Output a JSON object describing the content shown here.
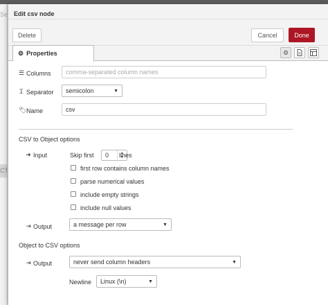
{
  "left_strip": {
    "frag_top": "Se",
    "frag_mid": "CT"
  },
  "tray": {
    "title": "Edit csv node",
    "delete_label": "Delete",
    "cancel_label": "Cancel",
    "done_label": "Done",
    "accent_color": "#ad1625"
  },
  "tabs": {
    "properties_label": "Properties",
    "icons": [
      "gear-icon",
      "file-icon",
      "appearance-icon"
    ]
  },
  "form": {
    "columns_label": "Columns",
    "columns_placeholder": "comma-separated column names",
    "separator_label": "Separator",
    "separator_value": "semicolon",
    "name_label": "Name",
    "name_value": "csv"
  },
  "csv_to_object": {
    "title": "CSV to Object options",
    "input_label": "Input",
    "skip_first_label": "Skip first",
    "skip_first_value": "0",
    "lines_label": "lines",
    "checkboxes": [
      {
        "label": "first row contains column names",
        "checked": false
      },
      {
        "label": "parse numerical values",
        "checked": false
      },
      {
        "label": "include empty strings",
        "checked": false
      },
      {
        "label": "include null values",
        "checked": false
      }
    ],
    "output_label": "Output",
    "output_value": "a message per row"
  },
  "object_to_csv": {
    "title": "Object to CSV options",
    "output_label": "Output",
    "output_value": "never send column headers",
    "newline_label": "Newline",
    "newline_value": "Linux (\\n)"
  }
}
